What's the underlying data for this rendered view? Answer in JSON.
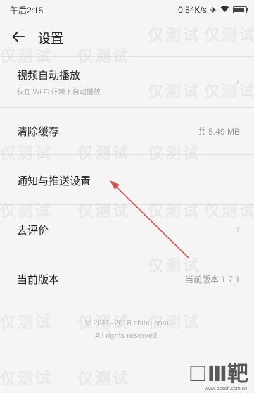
{
  "status_bar": {
    "time": "午后2:15",
    "net_speed": "0.84K/s",
    "battery_level": 0.85
  },
  "toolbar": {
    "title": "设置"
  },
  "settings": {
    "autoplay": {
      "label": "视频自动播放",
      "sub": "仅在 Wi-Fi 环境下自动播放"
    },
    "cache": {
      "label": "清除缓存",
      "value": "共 5.49 MB"
    },
    "notifications": {
      "label": "通知与推送设置"
    },
    "rate": {
      "label": "去评价"
    },
    "version": {
      "label": "当前版本",
      "value": "当前版本 1.7.1"
    }
  },
  "footer": {
    "copyright": "© 2011–2018 zhihu.com",
    "rights": "All rights reserved."
  },
  "watermark_text": "仅测试",
  "logo": {
    "mark": "☐Ⅲ靶",
    "url": "www.pcsoft.com.cn"
  },
  "colors": {
    "annotation_arrow": "#d9534f"
  }
}
